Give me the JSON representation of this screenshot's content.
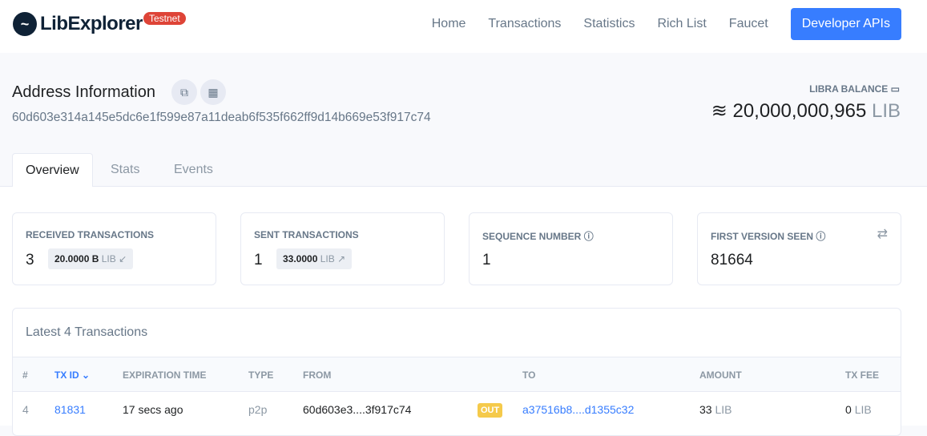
{
  "brand": {
    "name": "LibExplorer",
    "badge": "Testnet"
  },
  "nav": {
    "items": [
      "Home",
      "Transactions",
      "Statistics",
      "Rich List",
      "Faucet"
    ],
    "cta": "Developer APIs"
  },
  "address": {
    "title": "Address Information",
    "value": "60d603e314a145e5dc6e1f599e87a11deab6f535f662ff9d14b669e53f917c74"
  },
  "balance": {
    "label": "LIBRA BALANCE",
    "symbol": "≋",
    "amount": "20,000,000,965",
    "unit": "LIB"
  },
  "tabs": [
    "Overview",
    "Stats",
    "Events"
  ],
  "cards": {
    "received": {
      "label": "RECEIVED TRANSACTIONS",
      "count": "3",
      "amount": "20.0000 B",
      "unit": "LIB",
      "arrow": "↙"
    },
    "sent": {
      "label": "SENT TRANSACTIONS",
      "count": "1",
      "amount": "33.0000",
      "unit": "LIB",
      "arrow": "↗"
    },
    "sequence": {
      "label": "SEQUENCE NUMBER",
      "value": "1"
    },
    "first_version": {
      "label": "FIRST VERSION SEEN",
      "value": "81664"
    }
  },
  "table": {
    "title": "Latest 4 Transactions",
    "columns": [
      "#",
      "TX ID",
      "EXPIRATION TIME",
      "TYPE",
      "FROM",
      "TO",
      "AMOUNT",
      "TX FEE"
    ],
    "rows": [
      {
        "n": "4",
        "txid": "81831",
        "time": "17 secs ago",
        "type": "p2p",
        "from": "60d603e3....3f917c74",
        "dir": "OUT",
        "to": "a37516b8....d1355c32",
        "amount": "33",
        "amount_unit": "LIB",
        "fee": "0",
        "fee_unit": "LIB"
      }
    ]
  }
}
